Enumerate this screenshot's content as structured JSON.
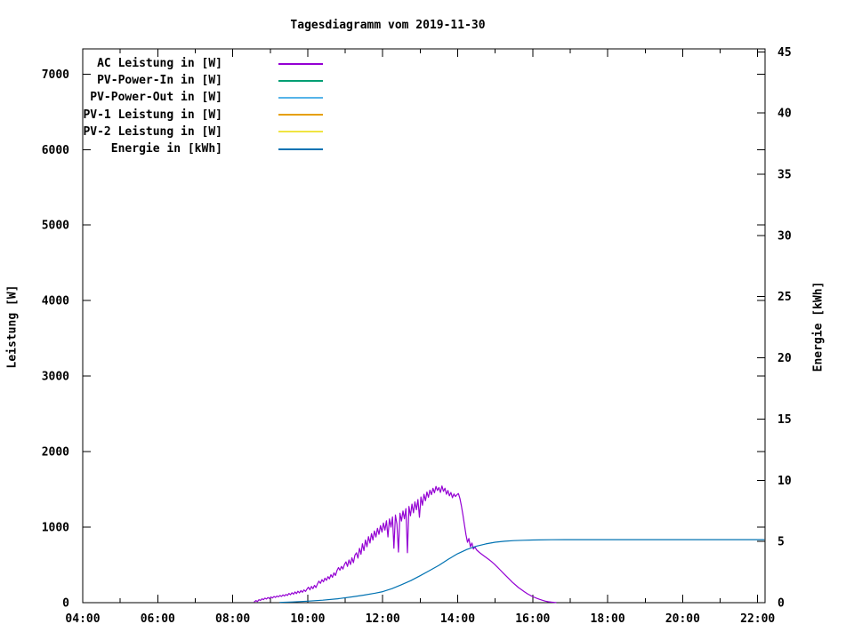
{
  "chart": {
    "title": "Tagesdiagramm vom 2019-11-30",
    "y1_label": "Leistung [W]",
    "y2_label": "Energie [kWh]",
    "background_color": "#ffffff",
    "border_color": "#000000",
    "legend": [
      {
        "label": "AC Leistung in [W]",
        "color": "#9400d3"
      },
      {
        "label": "PV-Power-In in [W]",
        "color": "#009e73"
      },
      {
        "label": "PV-Power-Out in [W]",
        "color": "#56b4e9"
      },
      {
        "label": "PV-1 Leistung in [W]",
        "color": "#e69f00"
      },
      {
        "label": "PV-2 Leistung in [W]",
        "color": "#f0e442"
      },
      {
        "label": "Energie in [kWh]",
        "color": "#0072b2"
      }
    ]
  },
  "chart_data": {
    "type": "line",
    "title": "Tagesdiagramm vom 2019-11-30",
    "grid": false,
    "legend_position": "top-left",
    "x_axis": {
      "label": "",
      "range_hours": [
        4.0,
        22.2
      ],
      "major_tick_hours": [
        4,
        6,
        8,
        10,
        12,
        14,
        16,
        18,
        20,
        22
      ],
      "major_tick_labels": [
        "04:00",
        "06:00",
        "08:00",
        "10:00",
        "12:00",
        "14:00",
        "16:00",
        "18:00",
        "20:00",
        "22:00"
      ],
      "minor_tick_hours": [
        5,
        7,
        9,
        11,
        13,
        15,
        17,
        19,
        21
      ]
    },
    "y1_axis": {
      "label": "Leistung [W]",
      "range": [
        0,
        7330
      ],
      "ticks": [
        0,
        1000,
        2000,
        3000,
        4000,
        5000,
        6000,
        7000
      ]
    },
    "y2_axis": {
      "label": "Energie [kWh]",
      "range": [
        0,
        45.2
      ],
      "ticks": [
        0,
        5,
        10,
        15,
        20,
        25,
        30,
        35,
        40,
        45
      ]
    },
    "series": [
      {
        "name": "AC Leistung in [W]",
        "color": "#9400d3",
        "axis": "y1",
        "points": [
          [
            8.57,
            8
          ],
          [
            8.62,
            28
          ],
          [
            8.66,
            15
          ],
          [
            8.7,
            40
          ],
          [
            8.74,
            30
          ],
          [
            8.78,
            52
          ],
          [
            8.82,
            40
          ],
          [
            8.86,
            60
          ],
          [
            8.9,
            48
          ],
          [
            8.94,
            68
          ],
          [
            8.98,
            55
          ],
          [
            9.02,
            75
          ],
          [
            9.06,
            62
          ],
          [
            9.1,
            82
          ],
          [
            9.14,
            70
          ],
          [
            9.18,
            88
          ],
          [
            9.22,
            76
          ],
          [
            9.26,
            95
          ],
          [
            9.3,
            82
          ],
          [
            9.34,
            102
          ],
          [
            9.38,
            88
          ],
          [
            9.42,
            110
          ],
          [
            9.46,
            95
          ],
          [
            9.5,
            122
          ],
          [
            9.54,
            105
          ],
          [
            9.58,
            132
          ],
          [
            9.62,
            112
          ],
          [
            9.66,
            142
          ],
          [
            9.7,
            120
          ],
          [
            9.74,
            152
          ],
          [
            9.78,
            130
          ],
          [
            9.82,
            160
          ],
          [
            9.86,
            138
          ],
          [
            9.9,
            170
          ],
          [
            9.94,
            148
          ],
          [
            9.98,
            180
          ],
          [
            10.02,
            205
          ],
          [
            10.06,
            170
          ],
          [
            10.1,
            215
          ],
          [
            10.14,
            185
          ],
          [
            10.18,
            230
          ],
          [
            10.22,
            200
          ],
          [
            10.26,
            250
          ],
          [
            10.3,
            285
          ],
          [
            10.34,
            255
          ],
          [
            10.38,
            305
          ],
          [
            10.42,
            275
          ],
          [
            10.46,
            325
          ],
          [
            10.5,
            295
          ],
          [
            10.54,
            345
          ],
          [
            10.58,
            315
          ],
          [
            10.62,
            370
          ],
          [
            10.66,
            335
          ],
          [
            10.7,
            395
          ],
          [
            10.74,
            360
          ],
          [
            10.78,
            425
          ],
          [
            10.82,
            465
          ],
          [
            10.86,
            430
          ],
          [
            10.9,
            480
          ],
          [
            10.94,
            445
          ],
          [
            10.98,
            505
          ],
          [
            11.02,
            540
          ],
          [
            11.06,
            480
          ],
          [
            11.1,
            565
          ],
          [
            11.14,
            505
          ],
          [
            11.18,
            595
          ],
          [
            11.22,
            530
          ],
          [
            11.26,
            630
          ],
          [
            11.3,
            660
          ],
          [
            11.34,
            590
          ],
          [
            11.38,
            720
          ],
          [
            11.42,
            640
          ],
          [
            11.46,
            780
          ],
          [
            11.5,
            690
          ],
          [
            11.54,
            830
          ],
          [
            11.58,
            740
          ],
          [
            11.62,
            875
          ],
          [
            11.66,
            790
          ],
          [
            11.7,
            915
          ],
          [
            11.74,
            830
          ],
          [
            11.78,
            950
          ],
          [
            11.82,
            870
          ],
          [
            11.86,
            985
          ],
          [
            11.9,
            905
          ],
          [
            11.94,
            1020
          ],
          [
            11.98,
            935
          ],
          [
            12.02,
            1055
          ],
          [
            12.06,
            960
          ],
          [
            12.1,
            1085
          ],
          [
            12.14,
            870
          ],
          [
            12.18,
            1110
          ],
          [
            12.22,
            1000
          ],
          [
            12.26,
            1135
          ],
          [
            12.3,
            720
          ],
          [
            12.34,
            1160
          ],
          [
            12.38,
            1040
          ],
          [
            12.42,
            670
          ],
          [
            12.46,
            1185
          ],
          [
            12.5,
            1080
          ],
          [
            12.54,
            1215
          ],
          [
            12.58,
            1110
          ],
          [
            12.62,
            1245
          ],
          [
            12.66,
            660
          ],
          [
            12.7,
            1275
          ],
          [
            12.74,
            1150
          ],
          [
            12.78,
            1305
          ],
          [
            12.82,
            1190
          ],
          [
            12.86,
            1335
          ],
          [
            12.9,
            1230
          ],
          [
            12.94,
            1365
          ],
          [
            12.98,
            1130
          ],
          [
            13.02,
            1400
          ],
          [
            13.06,
            1290
          ],
          [
            13.1,
            1435
          ],
          [
            13.14,
            1350
          ],
          [
            13.18,
            1465
          ],
          [
            13.22,
            1395
          ],
          [
            13.26,
            1490
          ],
          [
            13.3,
            1430
          ],
          [
            13.34,
            1515
          ],
          [
            13.38,
            1455
          ],
          [
            13.42,
            1540
          ],
          [
            13.46,
            1485
          ],
          [
            13.5,
            1525
          ],
          [
            13.54,
            1460
          ],
          [
            13.58,
            1545
          ],
          [
            13.62,
            1475
          ],
          [
            13.66,
            1515
          ],
          [
            13.7,
            1435
          ],
          [
            13.74,
            1485
          ],
          [
            13.78,
            1415
          ],
          [
            13.82,
            1460
          ],
          [
            13.86,
            1390
          ],
          [
            13.9,
            1440
          ],
          [
            13.94,
            1405
          ],
          [
            13.98,
            1430
          ],
          [
            14.02,
            1445
          ],
          [
            14.06,
            1380
          ],
          [
            14.1,
            1280
          ],
          [
            14.14,
            1160
          ],
          [
            14.18,
            1030
          ],
          [
            14.22,
            900
          ],
          [
            14.26,
            800
          ],
          [
            14.3,
            850
          ],
          [
            14.34,
            740
          ],
          [
            14.38,
            790
          ],
          [
            14.42,
            710
          ],
          [
            14.46,
            740
          ],
          [
            14.5,
            700
          ],
          [
            14.58,
            665
          ],
          [
            14.66,
            635
          ],
          [
            14.74,
            605
          ],
          [
            14.82,
            575
          ],
          [
            14.9,
            545
          ],
          [
            14.98,
            510
          ],
          [
            15.06,
            470
          ],
          [
            15.14,
            430
          ],
          [
            15.22,
            390
          ],
          [
            15.3,
            350
          ],
          [
            15.38,
            310
          ],
          [
            15.46,
            270
          ],
          [
            15.54,
            235
          ],
          [
            15.62,
            200
          ],
          [
            15.7,
            172
          ],
          [
            15.78,
            145
          ],
          [
            15.86,
            118
          ],
          [
            15.94,
            95
          ],
          [
            16.02,
            76
          ],
          [
            16.1,
            60
          ],
          [
            16.18,
            45
          ],
          [
            16.26,
            32
          ],
          [
            16.34,
            20
          ],
          [
            16.42,
            12
          ],
          [
            16.5,
            7
          ],
          [
            16.58,
            3
          ],
          [
            16.63,
            1
          ]
        ]
      },
      {
        "name": "PV-Power-In in [W]",
        "color": "#009e73",
        "axis": "y1",
        "points": []
      },
      {
        "name": "PV-Power-Out in [W]",
        "color": "#56b4e9",
        "axis": "y1",
        "points": []
      },
      {
        "name": "PV-1 Leistung in [W]",
        "color": "#e69f00",
        "axis": "y1",
        "points": []
      },
      {
        "name": "PV-2 Leistung in [W]",
        "color": "#f0e442",
        "axis": "y1",
        "points": []
      },
      {
        "name": "Energie in [kWh]",
        "color": "#0072b2",
        "axis": "y2",
        "points": [
          [
            9.25,
            0.02
          ],
          [
            9.6,
            0.06
          ],
          [
            10.0,
            0.12
          ],
          [
            10.4,
            0.2
          ],
          [
            10.8,
            0.32
          ],
          [
            11.2,
            0.48
          ],
          [
            11.5,
            0.62
          ],
          [
            11.8,
            0.78
          ],
          [
            12.0,
            0.9
          ],
          [
            12.25,
            1.15
          ],
          [
            12.5,
            1.47
          ],
          [
            12.75,
            1.8
          ],
          [
            13.0,
            2.2
          ],
          [
            13.25,
            2.62
          ],
          [
            13.5,
            3.05
          ],
          [
            13.75,
            3.55
          ],
          [
            14.0,
            4.0
          ],
          [
            14.25,
            4.35
          ],
          [
            14.5,
            4.62
          ],
          [
            14.75,
            4.8
          ],
          [
            15.0,
            4.94
          ],
          [
            15.25,
            5.02
          ],
          [
            15.5,
            5.07
          ],
          [
            15.75,
            5.1
          ],
          [
            16.0,
            5.12
          ],
          [
            16.5,
            5.14
          ],
          [
            17.0,
            5.15
          ],
          [
            18.0,
            5.15
          ],
          [
            19.0,
            5.15
          ],
          [
            20.0,
            5.15
          ],
          [
            21.0,
            5.15
          ],
          [
            22.18,
            5.15
          ]
        ]
      }
    ]
  }
}
